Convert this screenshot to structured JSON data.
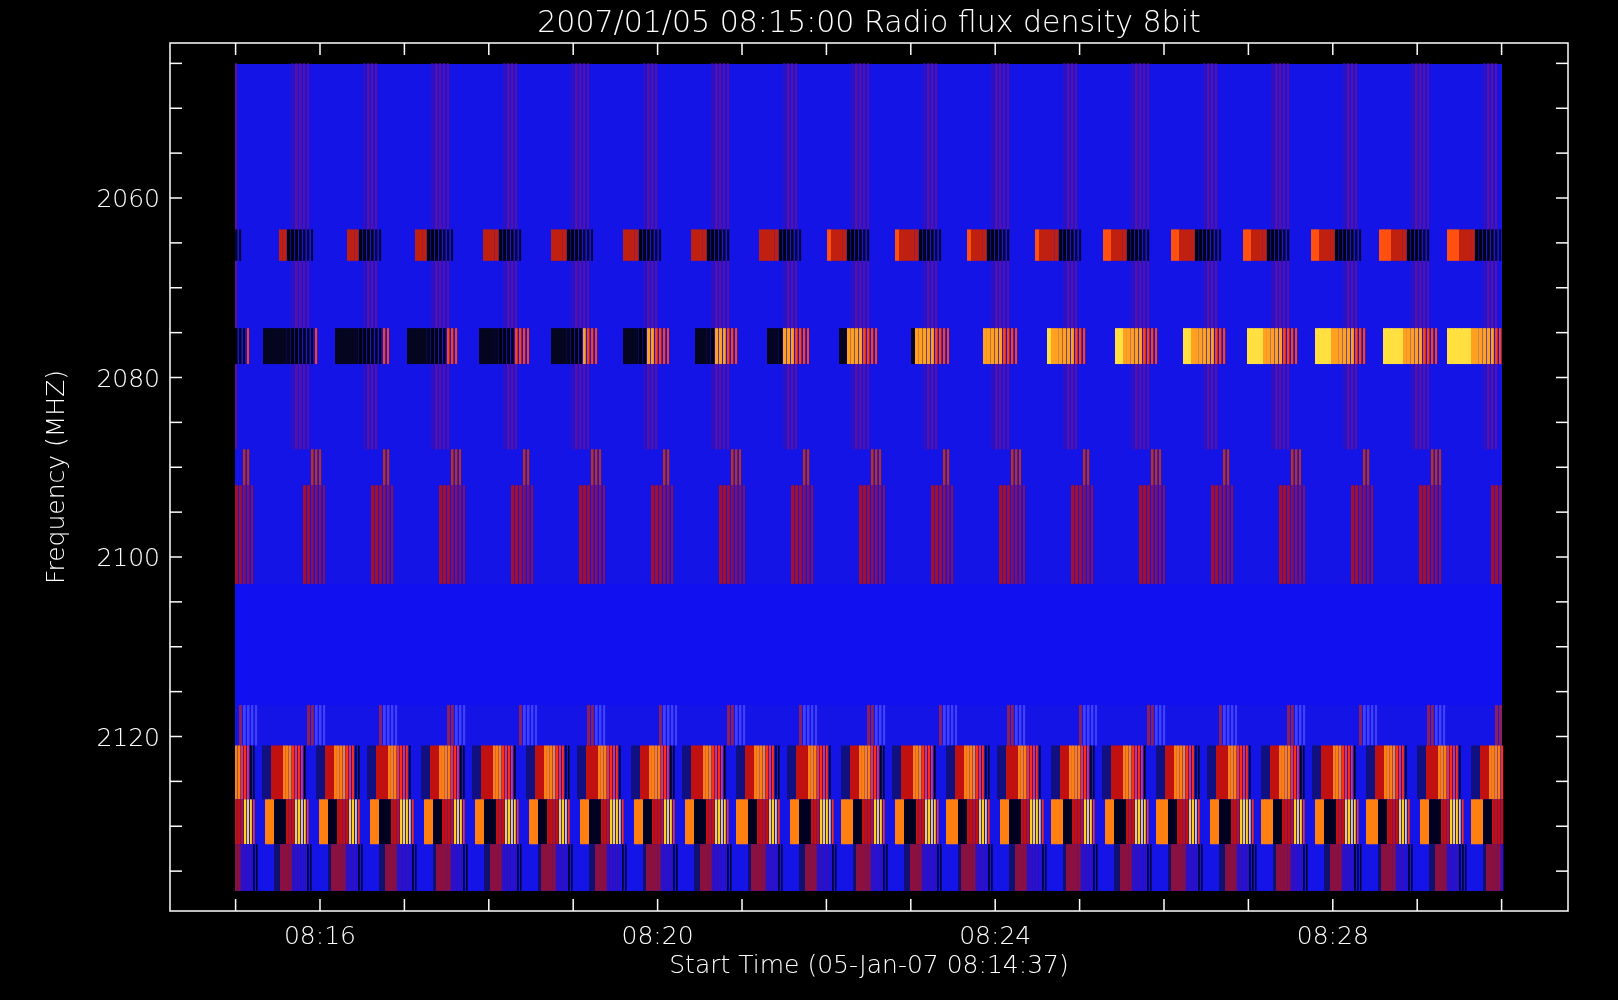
{
  "title": "2007/01/05 08:15:00 Radio flux density 8bit",
  "y_axis": {
    "label": "Frequency (MHZ)",
    "ticks": [
      "2060",
      "2080",
      "2100",
      "2120"
    ]
  },
  "x_axis": {
    "label": "Start Time (05-Jan-07 08:14:37)",
    "ticks": [
      "08:16",
      "08:20",
      "08:24",
      "08:28"
    ]
  }
}
